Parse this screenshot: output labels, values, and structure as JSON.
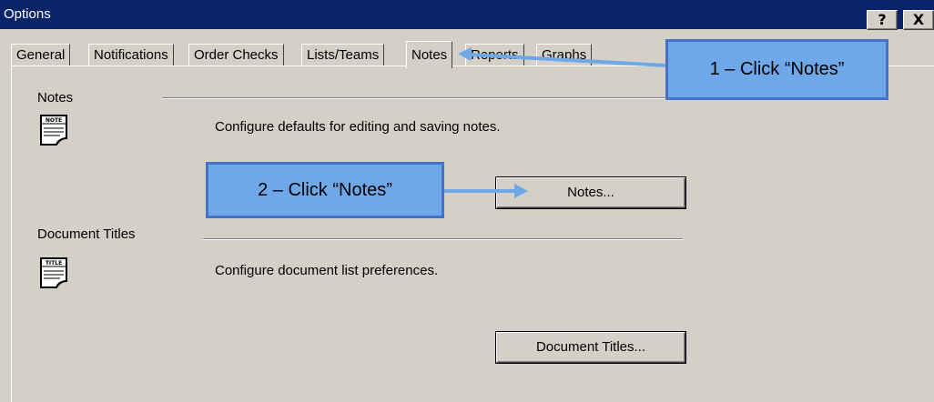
{
  "window": {
    "title": "Options",
    "help_label": "?",
    "close_label": "X"
  },
  "tabs": [
    {
      "label": "General"
    },
    {
      "label": "Notifications"
    },
    {
      "label": "Order Checks"
    },
    {
      "label": "Lists/Teams"
    },
    {
      "label": "Notes",
      "active": true
    },
    {
      "label": "Reports"
    },
    {
      "label": "Graphs"
    }
  ],
  "notes_section": {
    "label": "Notes",
    "icon_text": "NOTE",
    "description": "Configure defaults for editing and saving notes.",
    "button_label": "Notes..."
  },
  "titles_section": {
    "label": "Document Titles",
    "icon_text": "TITLE",
    "description": "Configure document list preferences.",
    "button_label": "Document Titles..."
  },
  "callouts": {
    "step1": "1 – Click “Notes”",
    "step2": "2 – Click “Notes”"
  },
  "colors": {
    "titlebar": "#0a246a",
    "dialog": "#d4d0c8",
    "callout_fill": "#6fa8e8",
    "callout_border": "#4472c4"
  }
}
